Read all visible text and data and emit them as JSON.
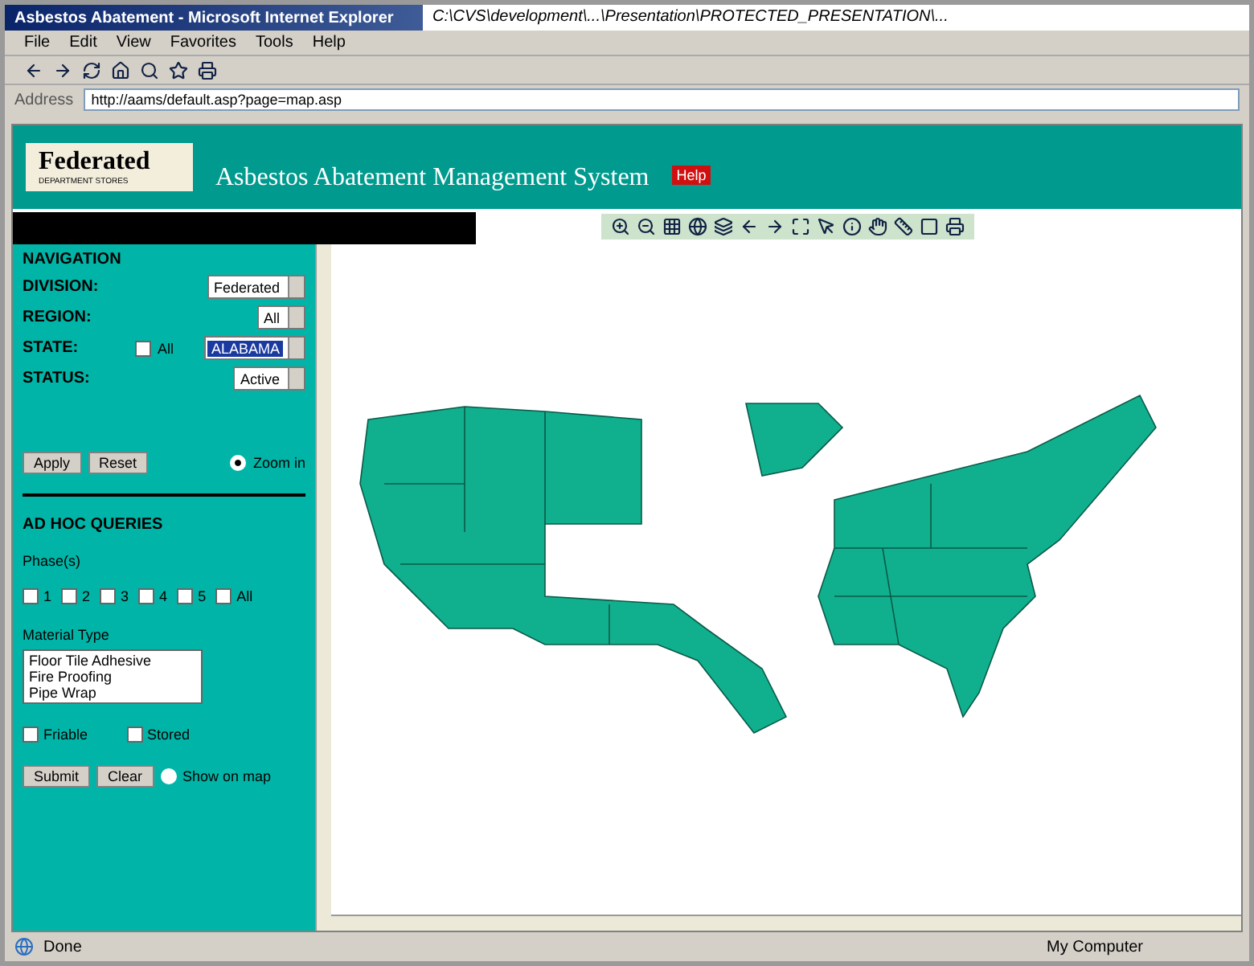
{
  "window": {
    "title": "Asbestos Abatement - Microsoft Internet Explorer",
    "background_title": "C:\\CVS\\development\\...\\Presentation\\PROTECTED_PRESENTATION\\..."
  },
  "menu": [
    "File",
    "Edit",
    "View",
    "Favorites",
    "Tools",
    "Help"
  ],
  "address": {
    "label": "Address",
    "value": "http://aams/default.asp?page=map.asp"
  },
  "header": {
    "logo": "Federated",
    "logo_sub": "DEPARTMENT STORES",
    "title": "Asbestos Abatement Management System",
    "badge": "Help"
  },
  "navigation": {
    "heading": "NAVIGATION",
    "fields": [
      {
        "label": "DIVISION:",
        "value": "Federated",
        "highlighted": false
      },
      {
        "label": "REGION:",
        "value": "All",
        "highlighted": false
      },
      {
        "label": "STATE:",
        "value": "ALABAMA",
        "highlighted": true,
        "all_label": "All",
        "all_checked": false
      },
      {
        "label": "STATUS:",
        "value": "Active",
        "highlighted": false
      }
    ],
    "buttons": [
      "Apply",
      "Reset"
    ],
    "option": {
      "label": "Zoom in",
      "selected": true
    }
  },
  "queries": {
    "heading": "AD HOC QUERIES",
    "phase_label": "Phase(s)",
    "phases": [
      {
        "label": "1",
        "checked": false
      },
      {
        "label": "2",
        "checked": false
      },
      {
        "label": "3",
        "checked": false
      },
      {
        "label": "4",
        "checked": false
      },
      {
        "label": "5",
        "checked": false
      },
      {
        "label": "All",
        "checked": false
      }
    ],
    "material_label": "Material Type",
    "materials": [
      "Floor Tile Adhesive",
      "Fire Proofing",
      "Pipe Wrap"
    ],
    "flags": [
      {
        "label": "Friable",
        "checked": false
      },
      {
        "label": "Stored",
        "checked": false
      }
    ],
    "buttons": [
      "Submit",
      "Clear"
    ],
    "option": {
      "label": "Show on map",
      "selected": false
    }
  },
  "status_bar": {
    "text": "Done",
    "zone": "My Computer"
  }
}
